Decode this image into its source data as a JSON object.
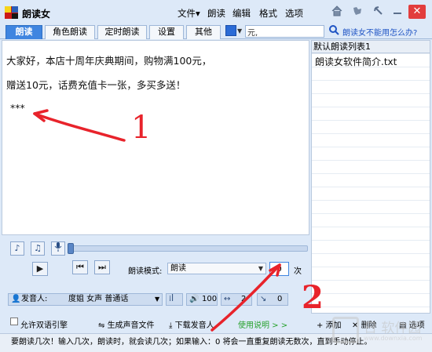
{
  "title_bar": {
    "app_title": "朗读女",
    "menu": [
      "文件▾",
      "朗读",
      "编辑",
      "格式",
      "选项"
    ],
    "icons": [
      "home-icon",
      "skin-icon",
      "minimize-icon",
      "close-icon"
    ],
    "close_label": "✕"
  },
  "tabs": [
    {
      "label": "朗读",
      "active": true
    },
    {
      "label": "角色朗读",
      "active": false
    },
    {
      "label": "定时朗读",
      "active": false
    },
    {
      "label": "设置",
      "active": false
    },
    {
      "label": "其他",
      "active": false
    }
  ],
  "search": {
    "value": "元,"
  },
  "help_link": "朗读女不能用怎么办?",
  "editor": {
    "lines": [
      "大家好，本店十周年庆典期间，购物满100元，",
      "赠送10元，话费充值卡一张，多买多送！",
      "***"
    ]
  },
  "playlist": {
    "header": "默认朗读列表1",
    "items": [
      "朗读女软件简介.txt"
    ]
  },
  "controls": {
    "mode_label": "朗读模式:",
    "mode_value": "朗读",
    "repeat_value": "0",
    "repeat_unit": "次",
    "progress": 0
  },
  "voice": {
    "label": "发音人:",
    "name": "度姐 女声 普通话",
    "volume": "100",
    "speed": "2",
    "pitch": "0"
  },
  "actions": {
    "allow_bilingual": "允许双语引擎",
    "generate_audio": "生成声音文件",
    "download_voice": "下载发音人",
    "usage": "使用说明 > >",
    "add": "添加",
    "delete": "删除",
    "options": "选项"
  },
  "status_text": "要朗读几次！输入几次，朗读时，就会读几次；如果输入：0 将会一直重复朗读无数次，直到手动停止。",
  "annotations": [
    "1",
    "2"
  ],
  "watermark": {
    "line1": "日 软件园",
    "line2": "www.downxia.com"
  },
  "colors": {
    "accent": "#3f85e0",
    "annotation": "#e8232b",
    "chrome": "#dde9f8"
  }
}
